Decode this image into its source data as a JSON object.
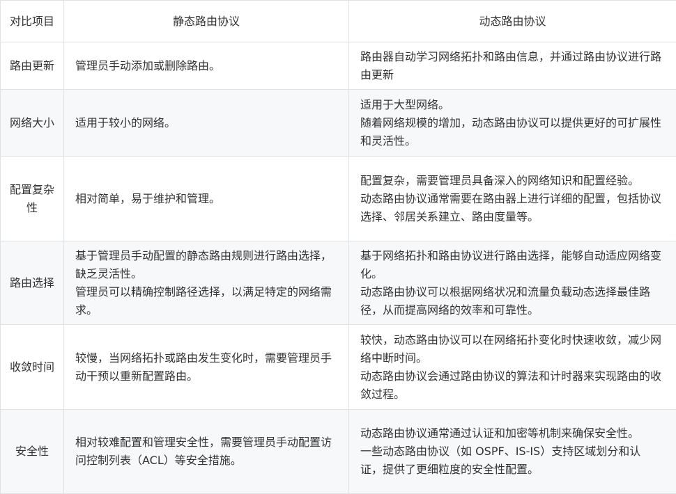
{
  "table": {
    "headers": [
      "对比项目",
      "静态路由协议",
      "动态路由协议"
    ],
    "rows": [
      {
        "item": "路由更新",
        "static": [
          "管理员手动添加或删除路由。"
        ],
        "dynamic": [
          "路由器自动学习网络拓扑和路由信息，并通过路由协议进行路由更新"
        ]
      },
      {
        "item": "网络大小",
        "static": [
          "适用于较小的网络。"
        ],
        "dynamic": [
          "适用于大型网络。",
          "随着网络规模的增加，动态路由协议可以提供更好的可扩展性和灵活性。"
        ]
      },
      {
        "item": "配置复杂性",
        "static": [
          "相对简单，易于维护和管理。"
        ],
        "dynamic": [
          "配置复杂，需要管理员具备深入的网络知识和配置经验。",
          "动态路由协议通常需要在路由器上进行详细的配置，包括协议选择、邻居关系建立、路由度量等。"
        ]
      },
      {
        "item": "路由选择",
        "static": [
          "基于管理员手动配置的静态路由规则进行路由选择，缺乏灵活性。",
          "管理员可以精确控制路径选择，以满足特定的网络需求。"
        ],
        "dynamic": [
          "基于网络拓扑和路由协议进行路由选择，能够自动适应网络变化。",
          "动态路由协议可以根据网络状况和流量负载动态选择最佳路径，从而提高网络的效率和可靠性。"
        ]
      },
      {
        "item": "收敛时间",
        "static": [
          "较慢，当网络拓扑或路由发生变化时，需要管理员手动干预以重新配置路由。"
        ],
        "dynamic": [
          "较快，动态路由协议可以在网络拓扑变化时快速收敛，减少网络中断时间。",
          "动态路由协议会通过路由协议的算法和计时器来实现路由的收敛过程。"
        ]
      },
      {
        "item": "安全性",
        "static": [
          "相对较难配置和管理安全性，需要管理员手动配置访问控制列表（ACL）等安全措施。"
        ],
        "dynamic": [
          "动态路由协议通常通过认证和加密等机制来确保安全性。",
          "一些动态路由协议（如 OSPF、IS-IS）支持区域划分和认证，提供了更细粒度的安全性配置。"
        ]
      }
    ]
  }
}
